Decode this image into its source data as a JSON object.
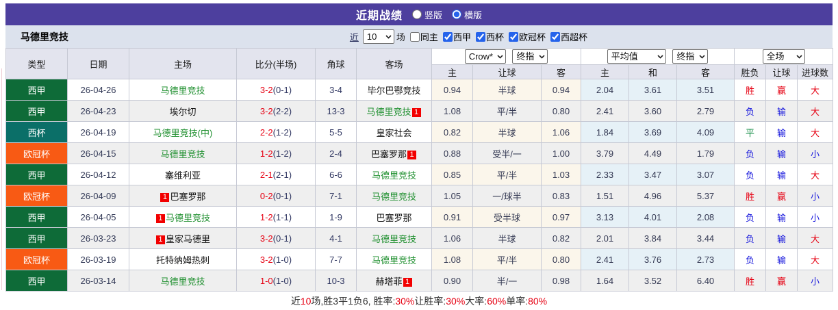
{
  "title_bar": {
    "title": "近期战绩",
    "options": [
      {
        "label": "竖版",
        "checked": false
      },
      {
        "label": "横版",
        "checked": true
      }
    ]
  },
  "filter_bar": {
    "team_name": "马德里竞技",
    "recent_label": "近",
    "recent_value": "10",
    "games_label": "场",
    "same_home_label": "同主",
    "same_home_checked": false,
    "leagues": [
      {
        "label": "西甲",
        "checked": true
      },
      {
        "label": "西杯",
        "checked": true
      },
      {
        "label": "欧冠杯",
        "checked": true
      },
      {
        "label": "西超杯",
        "checked": true
      }
    ]
  },
  "table": {
    "left_headers": [
      "类型",
      "日期",
      "主场",
      "比分(半场)",
      "角球",
      "客场"
    ],
    "selects": {
      "bookmaker": "Crow*",
      "bookmaker_stage": "终指",
      "average": "平均值",
      "average_stage": "终指",
      "scope": "全场"
    },
    "sub_headers": [
      "主",
      "让球",
      "客",
      "主",
      "和",
      "客",
      "胜负",
      "让球",
      "进球数"
    ],
    "league_colors": {
      "西甲": "#0E6B38",
      "西杯": "#0B6F68",
      "欧冠杯": "#F85A14"
    },
    "rows": [
      {
        "league": "西甲",
        "date": "26-04-26",
        "home": {
          "name": "马德里竞技",
          "green": true
        },
        "score": "3-2",
        "half": "(0-1)",
        "corners": "3-4",
        "away": {
          "name": "毕尔巴鄂竞技",
          "green": false
        },
        "handicap": [
          "0.94",
          "半球",
          "0.94"
        ],
        "europe": [
          "2.04",
          "3.61",
          "3.51"
        ],
        "outcome": [
          {
            "t": "胜",
            "c": "red"
          },
          {
            "t": "赢",
            "c": "red"
          },
          {
            "t": "大",
            "c": "red"
          }
        ]
      },
      {
        "league": "西甲",
        "date": "26-04-23",
        "home": {
          "name": "埃尔切",
          "green": false
        },
        "score": "3-2",
        "half": "(2-2)",
        "corners": "13-3",
        "away": {
          "name": "马德里竞技",
          "green": true,
          "badge": "1",
          "badge_pos": "after"
        },
        "handicap": [
          "1.08",
          "平/半",
          "0.80"
        ],
        "europe": [
          "2.41",
          "3.60",
          "2.79"
        ],
        "outcome": [
          {
            "t": "负",
            "c": "blue"
          },
          {
            "t": "输",
            "c": "blue"
          },
          {
            "t": "大",
            "c": "red"
          }
        ]
      },
      {
        "league": "西杯",
        "date": "26-04-19",
        "home": {
          "name": "马德里竞技(中)",
          "green": true
        },
        "score": "2-2",
        "half": "(1-2)",
        "corners": "5-5",
        "away": {
          "name": "皇家社会",
          "green": false
        },
        "handicap": [
          "0.82",
          "半球",
          "1.06"
        ],
        "europe": [
          "1.84",
          "3.69",
          "4.09"
        ],
        "outcome": [
          {
            "t": "平",
            "c": "green"
          },
          {
            "t": "输",
            "c": "blue"
          },
          {
            "t": "大",
            "c": "red"
          }
        ]
      },
      {
        "league": "欧冠杯",
        "date": "26-04-15",
        "home": {
          "name": "马德里竞技",
          "green": true
        },
        "score": "1-2",
        "half": "(1-2)",
        "corners": "2-4",
        "away": {
          "name": "巴塞罗那",
          "green": false,
          "badge": "1",
          "badge_pos": "after"
        },
        "handicap": [
          "0.88",
          "受半/一",
          "1.00"
        ],
        "europe": [
          "3.79",
          "4.49",
          "1.79"
        ],
        "outcome": [
          {
            "t": "负",
            "c": "blue"
          },
          {
            "t": "输",
            "c": "blue"
          },
          {
            "t": "小",
            "c": "blue"
          }
        ]
      },
      {
        "league": "西甲",
        "date": "26-04-12",
        "home": {
          "name": "塞维利亚",
          "green": false
        },
        "score": "2-1",
        "half": "(2-1)",
        "corners": "6-6",
        "away": {
          "name": "马德里竞技",
          "green": true
        },
        "handicap": [
          "0.85",
          "平/半",
          "1.03"
        ],
        "europe": [
          "2.33",
          "3.47",
          "3.07"
        ],
        "outcome": [
          {
            "t": "负",
            "c": "blue"
          },
          {
            "t": "输",
            "c": "blue"
          },
          {
            "t": "大",
            "c": "red"
          }
        ]
      },
      {
        "league": "欧冠杯",
        "date": "26-04-09",
        "home": {
          "name": "巴塞罗那",
          "green": false,
          "badge": "1",
          "badge_pos": "before"
        },
        "score": "0-2",
        "half": "(0-1)",
        "corners": "7-1",
        "away": {
          "name": "马德里竞技",
          "green": true
        },
        "handicap": [
          "1.05",
          "一/球半",
          "0.83"
        ],
        "europe": [
          "1.51",
          "4.96",
          "5.37"
        ],
        "outcome": [
          {
            "t": "胜",
            "c": "red"
          },
          {
            "t": "赢",
            "c": "red"
          },
          {
            "t": "小",
            "c": "blue"
          }
        ]
      },
      {
        "league": "西甲",
        "date": "26-04-05",
        "home": {
          "name": "马德里竞技",
          "green": true,
          "badge": "1",
          "badge_pos": "before"
        },
        "score": "1-2",
        "half": "(1-1)",
        "corners": "1-9",
        "away": {
          "name": "巴塞罗那",
          "green": false
        },
        "handicap": [
          "0.91",
          "受半球",
          "0.97"
        ],
        "europe": [
          "3.13",
          "4.01",
          "2.08"
        ],
        "outcome": [
          {
            "t": "负",
            "c": "blue"
          },
          {
            "t": "输",
            "c": "blue"
          },
          {
            "t": "小",
            "c": "blue"
          }
        ]
      },
      {
        "league": "西甲",
        "date": "26-03-23",
        "home": {
          "name": "皇家马德里",
          "green": false,
          "badge": "1",
          "badge_pos": "before"
        },
        "score": "3-2",
        "half": "(0-1)",
        "corners": "4-1",
        "away": {
          "name": "马德里竞技",
          "green": true
        },
        "handicap": [
          "1.06",
          "半球",
          "0.82"
        ],
        "europe": [
          "2.01",
          "3.84",
          "3.44"
        ],
        "outcome": [
          {
            "t": "负",
            "c": "blue"
          },
          {
            "t": "输",
            "c": "blue"
          },
          {
            "t": "大",
            "c": "red"
          }
        ]
      },
      {
        "league": "欧冠杯",
        "date": "26-03-19",
        "home": {
          "name": "托特纳姆热刺",
          "green": false
        },
        "score": "3-2",
        "half": "(1-0)",
        "corners": "7-7",
        "away": {
          "name": "马德里竞技",
          "green": true
        },
        "handicap": [
          "1.08",
          "平/半",
          "0.80"
        ],
        "europe": [
          "2.41",
          "3.76",
          "2.73"
        ],
        "outcome": [
          {
            "t": "负",
            "c": "blue"
          },
          {
            "t": "输",
            "c": "blue"
          },
          {
            "t": "大",
            "c": "red"
          }
        ]
      },
      {
        "league": "西甲",
        "date": "26-03-14",
        "home": {
          "name": "马德里竞技",
          "green": true
        },
        "score": "1-0",
        "half": "(1-0)",
        "corners": "10-3",
        "away": {
          "name": "赫塔菲",
          "green": false,
          "badge": "1",
          "badge_pos": "after"
        },
        "handicap": [
          "0.90",
          "半/一",
          "0.98"
        ],
        "europe": [
          "1.64",
          "3.52",
          "6.40"
        ],
        "outcome": [
          {
            "t": "胜",
            "c": "red"
          },
          {
            "t": "赢",
            "c": "red"
          },
          {
            "t": "小",
            "c": "blue"
          }
        ]
      }
    ]
  },
  "footer": {
    "segments": [
      {
        "text": "近",
        "red": false
      },
      {
        "text": "10",
        "red": true
      },
      {
        "text": "场,胜3平1负6, 胜率:",
        "red": false
      },
      {
        "text": "30%",
        "red": true
      },
      {
        "text": " 让胜率:",
        "red": false
      },
      {
        "text": "30%",
        "red": true
      },
      {
        "text": " 大率:",
        "red": false
      },
      {
        "text": "60%",
        "red": true
      },
      {
        "text": " 单率:",
        "red": false
      },
      {
        "text": "80%",
        "red": true
      }
    ]
  }
}
